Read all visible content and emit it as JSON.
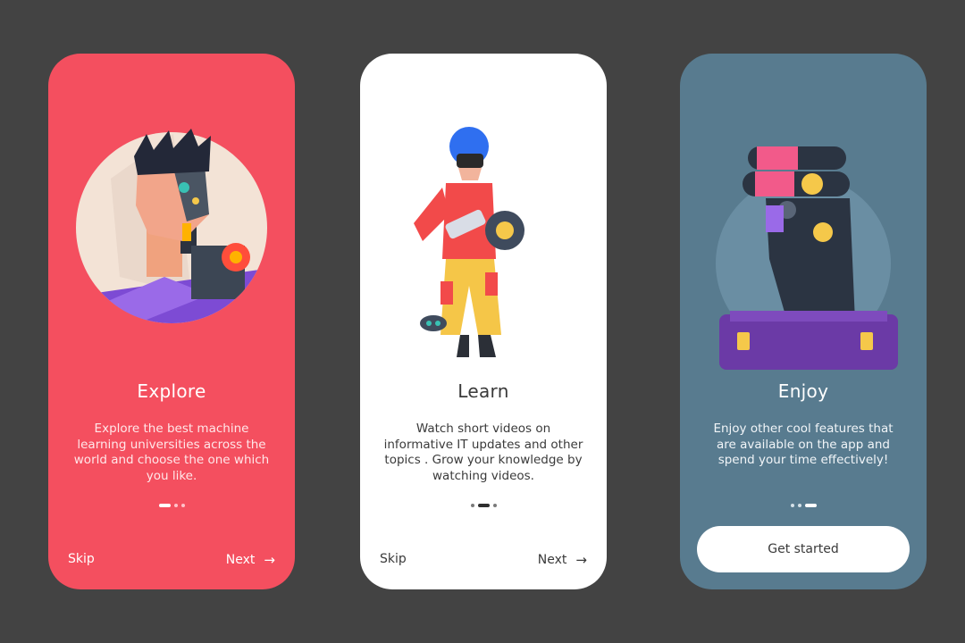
{
  "screens": [
    {
      "title": "Explore",
      "description": "Explore the best machine learning universities across the world and choose the one which you like.",
      "skip_label": "Skip",
      "next_label": "Next",
      "next_icon": "arrow-right-icon",
      "active_page": 1,
      "page_count": 3,
      "illustration": "cyborg-man-portrait",
      "background": "#f44f5f"
    },
    {
      "title": "Learn",
      "description": "Watch short videos on informative IT updates and other topics . Grow your knowledge by watching videos.",
      "skip_label": "Skip",
      "next_label": "Next",
      "next_icon": "arrow-right-icon",
      "active_page": 2,
      "page_count": 3,
      "illustration": "vr-headset-person",
      "background": "#ffffff"
    },
    {
      "title": "Enjoy",
      "description": "Enjoy other cool features that are available on the app and spend your time effectively!",
      "cta_label": "Get started",
      "active_page": 3,
      "page_count": 3,
      "illustration": "robot-head-on-platform",
      "background": "#587b8f"
    }
  ],
  "colors": {
    "page_background": "#434343",
    "accent_red": "#f44f5f",
    "slate": "#587b8f"
  }
}
